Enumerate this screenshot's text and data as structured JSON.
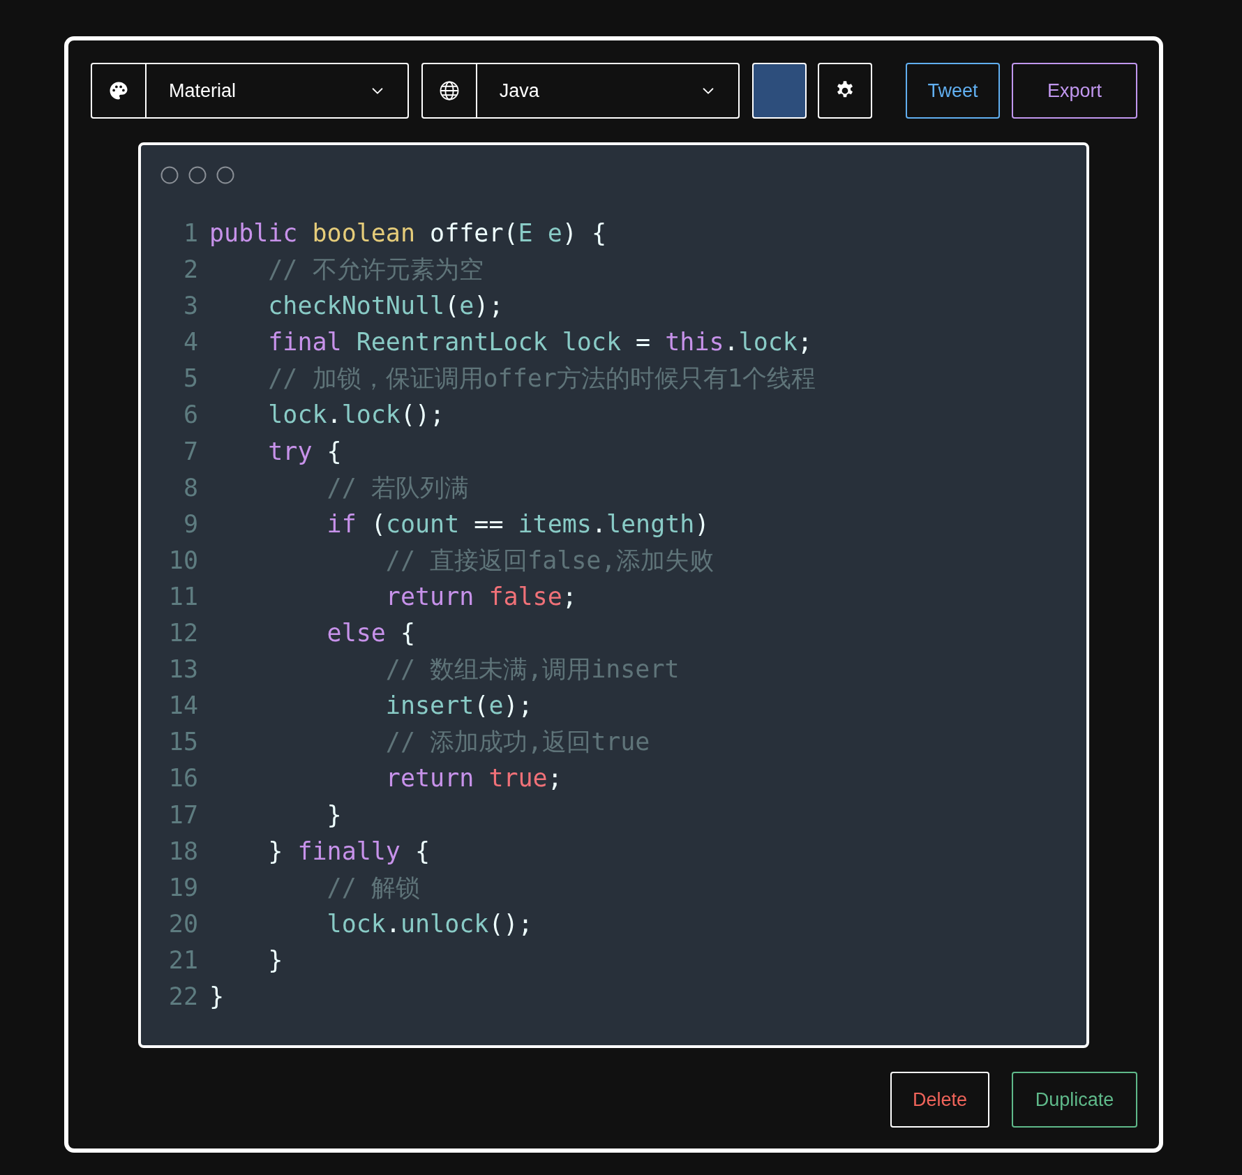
{
  "toolbar": {
    "theme_dropdown": {
      "label": "Material"
    },
    "language_dropdown": {
      "label": "Java"
    },
    "buttons": [
      {
        "kind": "tweet",
        "label": "Tweet"
      },
      {
        "kind": "export",
        "label": "Export"
      }
    ]
  },
  "code_window": {
    "lines": [
      {
        "number": "1",
        "tokens": [
          {
            "kind": "keyword",
            "text": "public "
          },
          {
            "kind": "type",
            "text": "boolean "
          },
          {
            "kind": "plain",
            "text": "offer("
          },
          {
            "kind": "ident",
            "text": "E e"
          },
          {
            "kind": "plain",
            "text": ") {"
          }
        ]
      },
      {
        "number": "2",
        "tokens": [
          {
            "kind": "comment",
            "text": "    // 不允许元素为空"
          }
        ]
      },
      {
        "number": "3",
        "tokens": [
          {
            "kind": "ident",
            "text": "    checkNotNull"
          },
          {
            "kind": "plain",
            "text": "("
          },
          {
            "kind": "ident",
            "text": "e"
          },
          {
            "kind": "plain",
            "text": ");"
          }
        ]
      },
      {
        "number": "4",
        "tokens": [
          {
            "kind": "keyword",
            "text": "    final "
          },
          {
            "kind": "ident",
            "text": "ReentrantLock lock"
          },
          {
            "kind": "plain",
            "text": " = "
          },
          {
            "kind": "keyword",
            "text": "this"
          },
          {
            "kind": "plain",
            "text": "."
          },
          {
            "kind": "ident",
            "text": "lock"
          },
          {
            "kind": "plain",
            "text": ";"
          }
        ]
      },
      {
        "number": "5",
        "tokens": [
          {
            "kind": "comment",
            "text": "    // 加锁，保证调用offer方法的时候只有1个线程"
          }
        ]
      },
      {
        "number": "6",
        "tokens": [
          {
            "kind": "ident",
            "text": "    lock"
          },
          {
            "kind": "plain",
            "text": "."
          },
          {
            "kind": "ident",
            "text": "lock"
          },
          {
            "kind": "plain",
            "text": "();"
          }
        ]
      },
      {
        "number": "7",
        "tokens": [
          {
            "kind": "keyword",
            "text": "    try "
          },
          {
            "kind": "plain",
            "text": "{"
          }
        ]
      },
      {
        "number": "8",
        "tokens": [
          {
            "kind": "comment",
            "text": "        // 若队列满"
          }
        ]
      },
      {
        "number": "9",
        "tokens": [
          {
            "kind": "keyword",
            "text": "        if "
          },
          {
            "kind": "plain",
            "text": "("
          },
          {
            "kind": "ident",
            "text": "count"
          },
          {
            "kind": "plain",
            "text": " == "
          },
          {
            "kind": "ident",
            "text": "items"
          },
          {
            "kind": "plain",
            "text": "."
          },
          {
            "kind": "ident",
            "text": "length"
          },
          {
            "kind": "plain",
            "text": ")"
          }
        ]
      },
      {
        "number": "10",
        "tokens": [
          {
            "kind": "comment",
            "text": "            // 直接返回false,添加失败"
          }
        ]
      },
      {
        "number": "11",
        "tokens": [
          {
            "kind": "keyword",
            "text": "            return "
          },
          {
            "kind": "literal",
            "text": "false"
          },
          {
            "kind": "plain",
            "text": ";"
          }
        ]
      },
      {
        "number": "12",
        "tokens": [
          {
            "kind": "keyword",
            "text": "        else "
          },
          {
            "kind": "plain",
            "text": "{"
          }
        ]
      },
      {
        "number": "13",
        "tokens": [
          {
            "kind": "comment",
            "text": "            // 数组未满,调用insert"
          }
        ]
      },
      {
        "number": "14",
        "tokens": [
          {
            "kind": "ident",
            "text": "            insert"
          },
          {
            "kind": "plain",
            "text": "("
          },
          {
            "kind": "ident",
            "text": "e"
          },
          {
            "kind": "plain",
            "text": ");"
          }
        ]
      },
      {
        "number": "15",
        "tokens": [
          {
            "kind": "comment",
            "text": "            // 添加成功,返回true"
          }
        ]
      },
      {
        "number": "16",
        "tokens": [
          {
            "kind": "keyword",
            "text": "            return "
          },
          {
            "kind": "literal",
            "text": "true"
          },
          {
            "kind": "plain",
            "text": ";"
          }
        ]
      },
      {
        "number": "17",
        "tokens": [
          {
            "kind": "plain",
            "text": "        }"
          }
        ]
      },
      {
        "number": "18",
        "tokens": [
          {
            "kind": "plain",
            "text": "    } "
          },
          {
            "kind": "keyword",
            "text": "finally "
          },
          {
            "kind": "plain",
            "text": "{"
          }
        ]
      },
      {
        "number": "19",
        "tokens": [
          {
            "kind": "comment",
            "text": "        // 解锁"
          }
        ]
      },
      {
        "number": "20",
        "tokens": [
          {
            "kind": "ident",
            "text": "        lock"
          },
          {
            "kind": "plain",
            "text": "."
          },
          {
            "kind": "ident",
            "text": "unlock"
          },
          {
            "kind": "plain",
            "text": "();"
          }
        ]
      },
      {
        "number": "21",
        "tokens": [
          {
            "kind": "plain",
            "text": "    }"
          }
        ]
      },
      {
        "number": "22",
        "tokens": [
          {
            "kind": "plain",
            "text": "}"
          }
        ]
      }
    ]
  },
  "actions": [
    {
      "kind": "delete",
      "label": "Delete"
    },
    {
      "kind": "duplicate",
      "label": "Duplicate"
    }
  ]
}
